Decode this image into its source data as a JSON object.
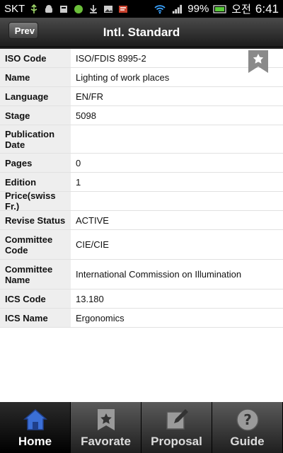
{
  "status_bar": {
    "carrier": "SKT",
    "battery": "99%",
    "ime": "오전",
    "time": "6:41"
  },
  "header": {
    "back_label": "Prev",
    "title": "Intl. Standard"
  },
  "details": [
    {
      "label": "ISO Code",
      "value": "ISO/FDIS 8995-2"
    },
    {
      "label": "Name",
      "value": "Lighting of work places"
    },
    {
      "label": "Language",
      "value": "EN/FR"
    },
    {
      "label": "Stage",
      "value": "5098"
    },
    {
      "label": "Publication Date",
      "value": ""
    },
    {
      "label": "Pages",
      "value": "0"
    },
    {
      "label": "Edition",
      "value": "1"
    },
    {
      "label": "Price(swiss Fr.)",
      "value": ""
    },
    {
      "label": "Revise Status",
      "value": "ACTIVE"
    },
    {
      "label": "Committee Code",
      "value": "CIE/CIE"
    },
    {
      "label": "Committee Name",
      "value": "International Commission on Illumination"
    },
    {
      "label": "ICS Code",
      "value": "13.180"
    },
    {
      "label": "ICS Name",
      "value": "Ergonomics"
    }
  ],
  "tabs": [
    {
      "label": "Home",
      "icon": "home-icon",
      "active": true
    },
    {
      "label": "Favorate",
      "icon": "star-icon",
      "active": false
    },
    {
      "label": "Proposal",
      "icon": "edit-icon",
      "active": false
    },
    {
      "label": "Guide",
      "icon": "help-icon",
      "active": false
    }
  ],
  "colors": {
    "home_icon": "#3b6fd6",
    "label_bg": "#eeeeee",
    "bookmark": "#8a8a8a"
  }
}
